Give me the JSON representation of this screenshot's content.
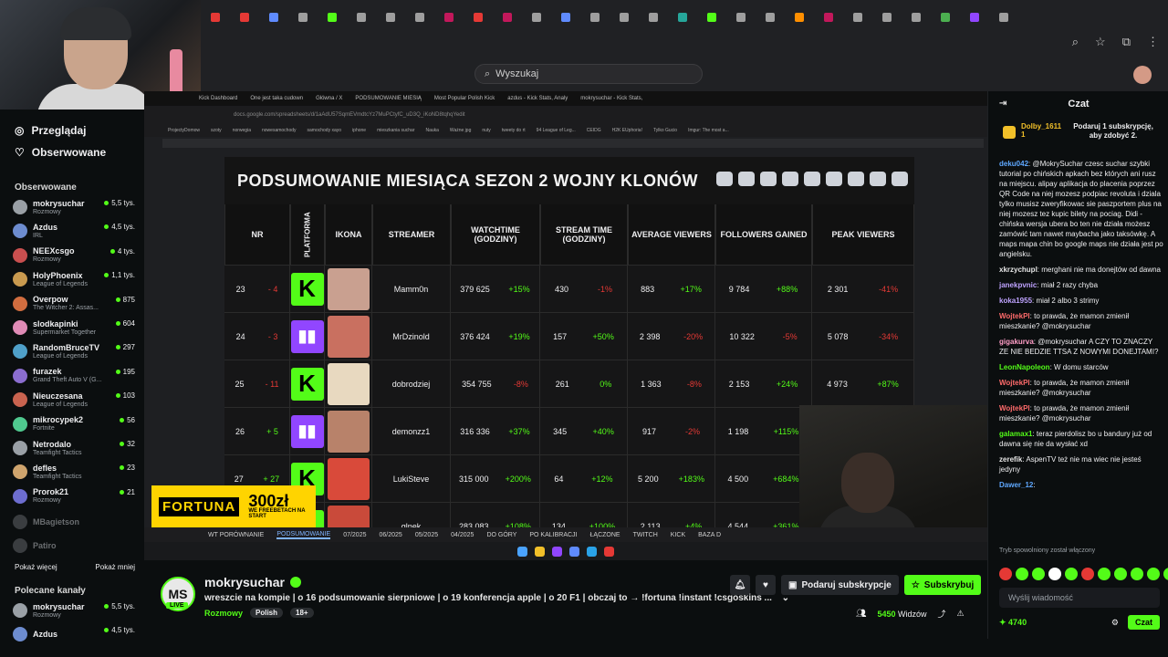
{
  "browser": {
    "tab_colors": [
      "#e53935",
      "#e53935",
      "#5f8bff",
      "#9e9e9e",
      "#53fc18",
      "#9e9e9e",
      "#9e9e9e",
      "#9e9e9e",
      "#c2185b",
      "#e53935",
      "#c2185b",
      "#9e9e9e",
      "#5f8bff",
      "#9e9e9e",
      "#9e9e9e",
      "#9e9e9e",
      "#26a69a",
      "#53fc18",
      "#9e9e9e",
      "#9e9e9e",
      "#ff8f00",
      "#c2185b",
      "#9e9e9e",
      "#9e9e9e",
      "#9e9e9e",
      "#4caf50",
      "#9146ff",
      "#9e9e9e"
    ],
    "search_placeholder": "Wyszukaj"
  },
  "sidebar": {
    "browse": "Przeglądaj",
    "following": "Obserwowane",
    "following_section": "Obserwowane",
    "channels": [
      {
        "name": "mokrysuchar",
        "category": "Rozmowy",
        "viewers": "5,5 tys.",
        "color": "#9aa0a6"
      },
      {
        "name": "Azdus",
        "category": "IRL",
        "viewers": "4,5 tys.",
        "color": "#6d8ccf"
      },
      {
        "name": "NEEXcsgo",
        "category": "Rozmowy",
        "viewers": "4 tys.",
        "color": "#c94f4f"
      },
      {
        "name": "HolyPhoenix",
        "category": "League of Legends",
        "viewers": "1,1 tys.",
        "color": "#c99a4f"
      },
      {
        "name": "Overpow",
        "category": "The Witcher 2: Assas...",
        "viewers": "875",
        "color": "#d16d3f"
      },
      {
        "name": "slodkapinki",
        "category": "Supermarket Together",
        "viewers": "604",
        "color": "#e08bb6"
      },
      {
        "name": "RandomBruceTV",
        "category": "League of Legends",
        "viewers": "297",
        "color": "#4fa0c9"
      },
      {
        "name": "furazek",
        "category": "Grand Theft Auto V (G...",
        "viewers": "195",
        "color": "#8b6dcf"
      },
      {
        "name": "Nieuczesana",
        "category": "League of Legends",
        "viewers": "103",
        "color": "#c9634f"
      },
      {
        "name": "mikrocypek2",
        "category": "Fortnite",
        "viewers": "56",
        "color": "#4fc98f"
      },
      {
        "name": "Netrodalo",
        "category": "Teamfight Tactics",
        "viewers": "32",
        "color": "#9aa0a6"
      },
      {
        "name": "defles",
        "category": "Teamfight Tactics",
        "viewers": "23",
        "color": "#cfa46d"
      },
      {
        "name": "Prorok21",
        "category": "Rozmowy",
        "viewers": "21",
        "color": "#6d6dcf"
      }
    ],
    "offline": [
      "MBagietson",
      "Patiro"
    ],
    "show_more": "Pokaż więcej",
    "show_less": "Pokaż mniej",
    "recommended_section": "Polecane kanały",
    "recommended": [
      {
        "name": "mokrysuchar",
        "category": "Rozmowy",
        "viewers": "5,5 tys.",
        "color": "#9aa0a6"
      },
      {
        "name": "Azdus",
        "category": "",
        "viewers": "4,5 tys.",
        "color": "#6d8ccf"
      }
    ]
  },
  "video": {
    "tabs": [
      "Kick Dashboard",
      "One jest taka cudown",
      "Główna / X",
      "PODSUMOWANIE MIESIĄ",
      "Most Popular Polish Kick",
      "azdus - Kick Stats, Analy",
      "mokrysuchar - Kick Stats,"
    ],
    "url": "docs.google.com/spreadsheets/d/1aAdU57SqmEVmdtcYz7MuPCtyfC_uD3Q_iKoND8tqhqYedit",
    "bookmarks": [
      "ProjectyDomow",
      "szoty",
      "norwegia",
      "nowesamochody",
      "samochody xayo",
      "iphone",
      "mieszkania suchar",
      "Nauka",
      "Ważne jpg",
      "nuty",
      "tweety do rt",
      "94 League of Leg...",
      "CEIDG",
      "H2K EUphoria!",
      "Tylko Gucio",
      "Imgur: The most a..."
    ],
    "sheet_title": "PODSUMOWANIE MIESIĄCA SEZON 2 WOJNY KLONÓW",
    "headers": {
      "nr": "NR",
      "platform": "PLATFORMA",
      "icon": "IKONA",
      "streamer": "STREAMER",
      "watchtime": "WATCHTIME (GODZINY)",
      "streamtime": "STREAM TIME (GODZINY)",
      "avg": "AVERAGE VIEWERS",
      "followers": "FOLLOWERS GAINED",
      "peak": "PEAK VIEWERS"
    },
    "rows": [
      {
        "nr": "23",
        "chg": "- 4",
        "platform": "kick",
        "streamer": "Mamm0n",
        "watch": "379 625",
        "watch_chg": "+15%",
        "stream": "430",
        "stream_chg": "-1%",
        "avg": "883",
        "avg_chg": "+17%",
        "fol": "9 784",
        "fol_chg": "+88%",
        "peak": "2 301",
        "peak_chg": "-41%",
        "face": "#c9a090"
      },
      {
        "nr": "24",
        "chg": "- 3",
        "platform": "twitch",
        "streamer": "MrDzinold",
        "watch": "376 424",
        "watch_chg": "+19%",
        "stream": "157",
        "stream_chg": "+50%",
        "avg": "2 398",
        "avg_chg": "-20%",
        "fol": "10 322",
        "fol_chg": "-5%",
        "peak": "5 078",
        "peak_chg": "-34%",
        "face": "#c97060"
      },
      {
        "nr": "25",
        "chg": "- 11",
        "platform": "kick",
        "streamer": "dobrodziej",
        "watch": "354 755",
        "watch_chg": "-8%",
        "stream": "261",
        "stream_chg": "0%",
        "avg": "1 363",
        "avg_chg": "-8%",
        "fol": "2 153",
        "fol_chg": "+24%",
        "peak": "4 973",
        "peak_chg": "+87%",
        "face": "#e8d9c0"
      },
      {
        "nr": "26",
        "chg": "+ 5",
        "platform": "twitch",
        "streamer": "demonzz1",
        "watch": "316 336",
        "watch_chg": "+37%",
        "stream": "345",
        "stream_chg": "+40%",
        "avg": "917",
        "avg_chg": "-2%",
        "fol": "1 198",
        "fol_chg": "+115%",
        "peak": "",
        "peak_chg": "",
        "face": "#b8826a"
      },
      {
        "nr": "27",
        "chg": "+ 27",
        "platform": "kick",
        "streamer": "LukiSteve",
        "watch": "315 000",
        "watch_chg": "+200%",
        "stream": "64",
        "stream_chg": "+12%",
        "avg": "5 200",
        "avg_chg": "+183%",
        "fol": "4 500",
        "fol_chg": "+684%",
        "peak": "",
        "peak_chg": "",
        "face": "#d94a3a"
      },
      {
        "nr": "",
        "chg": "",
        "platform": "kick",
        "streamer": "qlnek",
        "watch": "283 083",
        "watch_chg": "+108%",
        "stream": "134",
        "stream_chg": "+100%",
        "avg": "2 113",
        "avg_chg": "+4%",
        "fol": "4 544",
        "fol_chg": "+361%",
        "peak": "",
        "peak_chg": "",
        "face": "#c94a3a"
      }
    ],
    "sheet_tabs": [
      "WT PORÓWNANIE",
      "PODSUMOWANIE",
      "07/2025",
      "06/2025",
      "05/2025",
      "04/2025",
      "DO GÓRY",
      "PO KALIBRACJI",
      "ŁĄCZONE",
      "TWITCH",
      "KICK",
      "BAZA D"
    ],
    "active_sheet_tab": "PODSUMOWANIE",
    "fortuna_brand": "FORTUNA",
    "fortuna_amount": "300zł",
    "fortuna_sub": "WE FREEBETACH NA START"
  },
  "channel": {
    "logo_text": "MS",
    "live": "LIVE",
    "name": "mokrysuchar",
    "title": "wreszcie na kompie | o 16 podsumowanie sierpniowe | o 19 konferencja apple | o 20 F1 | obczaj to → !fortuna !instant !csgoskins ...",
    "category": "Rozmowy",
    "tags": [
      "Polish",
      "18+"
    ],
    "gift_sub": "Podaruj subskrypcje",
    "subscribe": "Subskrybuj",
    "viewers_count": "5450",
    "viewers_label": "Widzów"
  },
  "chat": {
    "title": "Czat",
    "pinned_user": "Dolby_1611",
    "pinned_count": "1",
    "pinned_text": "Podaruj 1 subskrypcję, aby zdobyć 2.",
    "messages": [
      {
        "user": "deku042",
        "color": "#5fa8ff",
        "text": "@MokrySuchar czesc suchar szybki tutorial po chińskich apkach bez których ani rusz na miejscu. alipay aplikacja do placenia poprzez QR Code na niej mozesz podpiac revoluta i dziala tylko musisz zweryfikowac sie paszportem plus na niej mozesz tez kupic bilety na pociag. Didi - chińska wersja ubera bo ten nie działa możesz zamówić tam nawet maybacha jako taksówkę. A maps mapa chin bo google maps nie działa jest po angielsku."
      },
      {
        "user": "xkrzychupl",
        "color": "#e6e6e6",
        "text": "merghani nie ma donejtów od dawna"
      },
      {
        "user": "janekpvnic",
        "color": "#bfa3ff",
        "text": "miał 2 razy chyba"
      },
      {
        "user": "koka1955",
        "color": "#bfa3ff",
        "text": "miał 2 albo 3 strimy"
      },
      {
        "user": "WojtekPl",
        "color": "#ff6b6b",
        "text": "to prawda, że mamon zmienił mieszkanie? @mokrysuchar"
      },
      {
        "user": "gigakurva",
        "color": "#ff9ec7",
        "text": "@mokrysuchar A CZY TO ZNACZY ZE NIE BEDZIE TTSA Z NOWYMI DONEJTAMI?"
      },
      {
        "user": "LeonNapoleon",
        "color": "#53fc18",
        "text": "W domu starców"
      },
      {
        "user": "WojtekPl",
        "color": "#ff6b6b",
        "text": "to prawda, że mamon zmienił mieszkanie? @mokrysuchar"
      },
      {
        "user": "WojtekPl",
        "color": "#ff6b6b",
        "text": "to prawda, że mamon zmienił mieszkanie? @mokrysuchar"
      },
      {
        "user": "galamax1",
        "color": "#53fc18",
        "text": "teraz pierdolisz bo u bandury już od dawna się nie da wysłać xd"
      },
      {
        "user": "zerefik",
        "color": "#e6e6e6",
        "text": "AspenTV też nie ma wiec nie jesteś jedyny"
      },
      {
        "user": "Dawer_12",
        "color": "#5fa8ff",
        "text": ""
      }
    ],
    "slow_mode": "Tryb spowolniony został włączony",
    "emote_colors": [
      "#e53935",
      "#53fc18",
      "#53fc18",
      "#ffffff",
      "#53fc18",
      "#e53935",
      "#53fc18",
      "#53fc18",
      "#53fc18",
      "#53fc18",
      "#53fc18",
      "#53fc18",
      "#ffffff",
      "#53fc18"
    ],
    "input_placeholder": "Wyślij wiadomość",
    "points": "4740",
    "send": "Czat"
  }
}
